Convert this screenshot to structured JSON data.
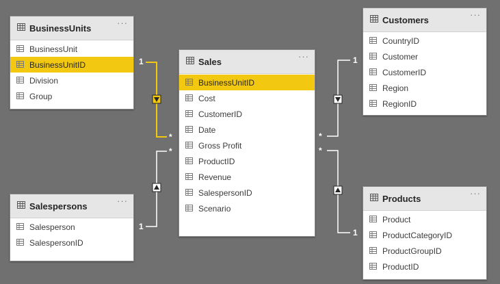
{
  "colors": {
    "canvas": "#707070",
    "highlight": "#f2c811",
    "line": "#ffffff",
    "line_active": "#f2c811"
  },
  "menu_glyph": "···",
  "tables": {
    "business_units": {
      "title": "BusinessUnits",
      "fields": [
        "BusinessUnit",
        "BusinessUnitID",
        "Division",
        "Group"
      ],
      "selected": "BusinessUnitID"
    },
    "sales": {
      "title": "Sales",
      "fields": [
        "BusinessUnitID",
        "Cost",
        "CustomerID",
        "Date",
        "Gross Profit",
        "ProductID",
        "Revenue",
        "SalespersonID",
        "Scenario"
      ],
      "selected": "BusinessUnitID"
    },
    "customers": {
      "title": "Customers",
      "fields": [
        "CountryID",
        "Customer",
        "CustomerID",
        "Region",
        "RegionID"
      ],
      "selected": ""
    },
    "salespersons": {
      "title": "Salespersons",
      "fields": [
        "Salesperson",
        "SalespersonID"
      ],
      "selected": ""
    },
    "products": {
      "title": "Products",
      "fields": [
        "Product",
        "ProductCategoryID",
        "ProductGroupID",
        "ProductID"
      ],
      "selected": ""
    }
  },
  "relationships": {
    "business_units_sales": {
      "one": "1",
      "many": "*",
      "direction": "down",
      "active": true
    },
    "salespersons_sales": {
      "one": "1",
      "many": "*",
      "direction": "up",
      "active": false
    },
    "customers_sales": {
      "one": "1",
      "many": "*",
      "direction": "down",
      "active": false
    },
    "products_sales": {
      "one": "1",
      "many": "*",
      "direction": "up",
      "active": false
    }
  }
}
